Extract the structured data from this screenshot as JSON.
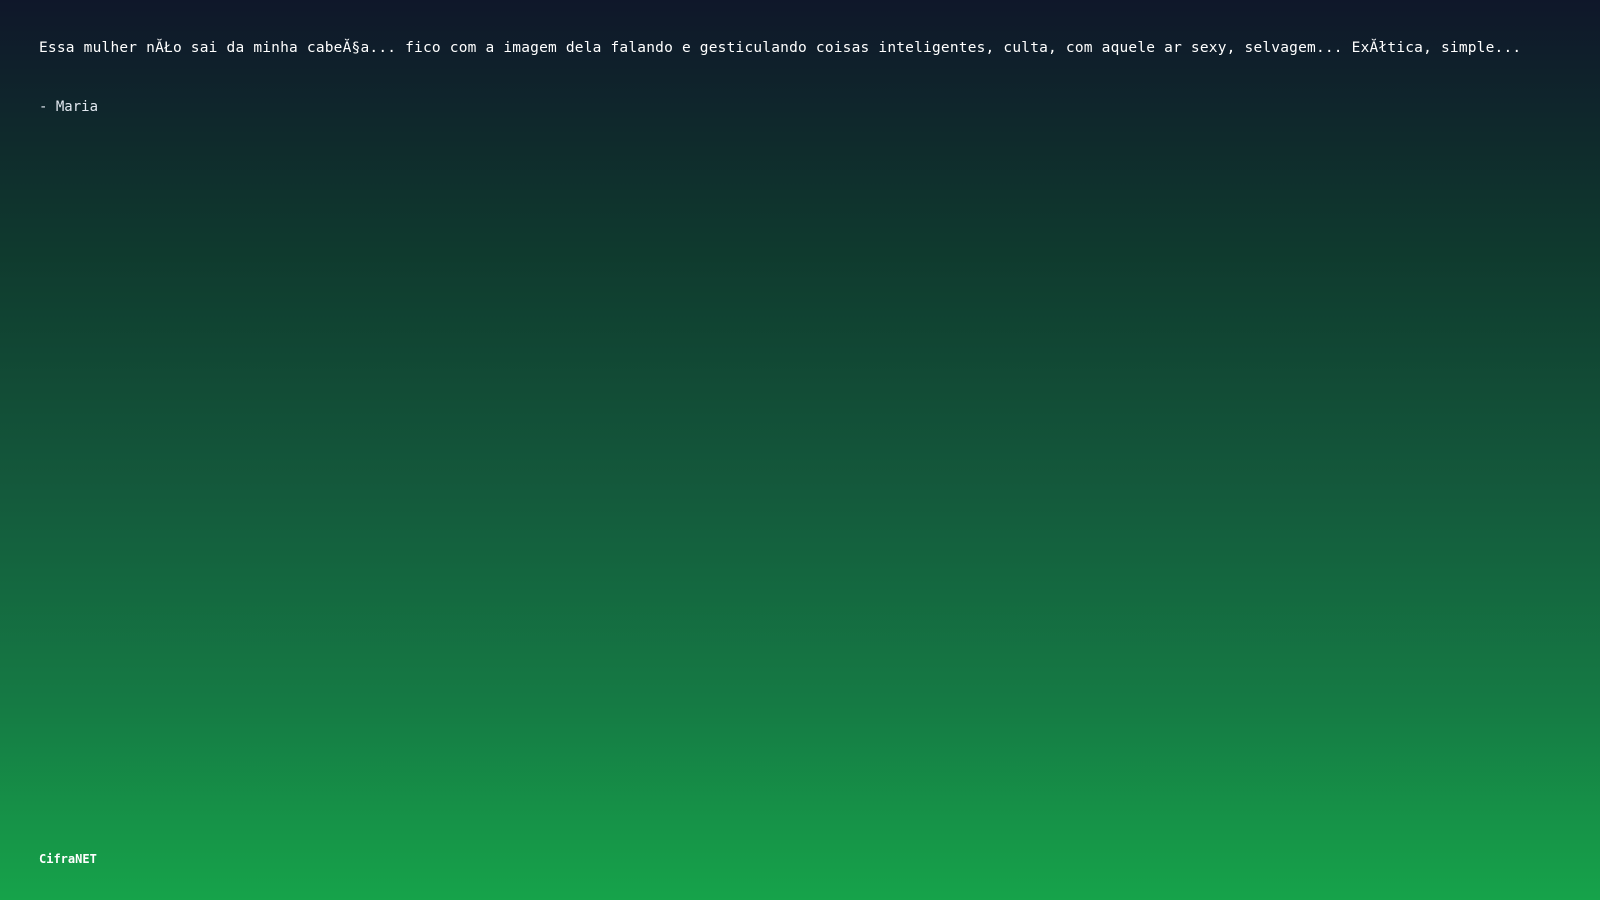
{
  "quote": {
    "text": "Essa mulher nĂŁo sai da minha cabeĂ§a... fico com a imagem dela falando e gesticulando coisas inteligentes, culta, com aquele ar sexy, selvagem... ExĂłtica, simple...",
    "author": "- Maria"
  },
  "brand": {
    "name": "CifraNET"
  },
  "colors": {
    "gradient_top": "#0f172a",
    "gradient_bottom": "#16a34a",
    "text": "#ffffff"
  }
}
